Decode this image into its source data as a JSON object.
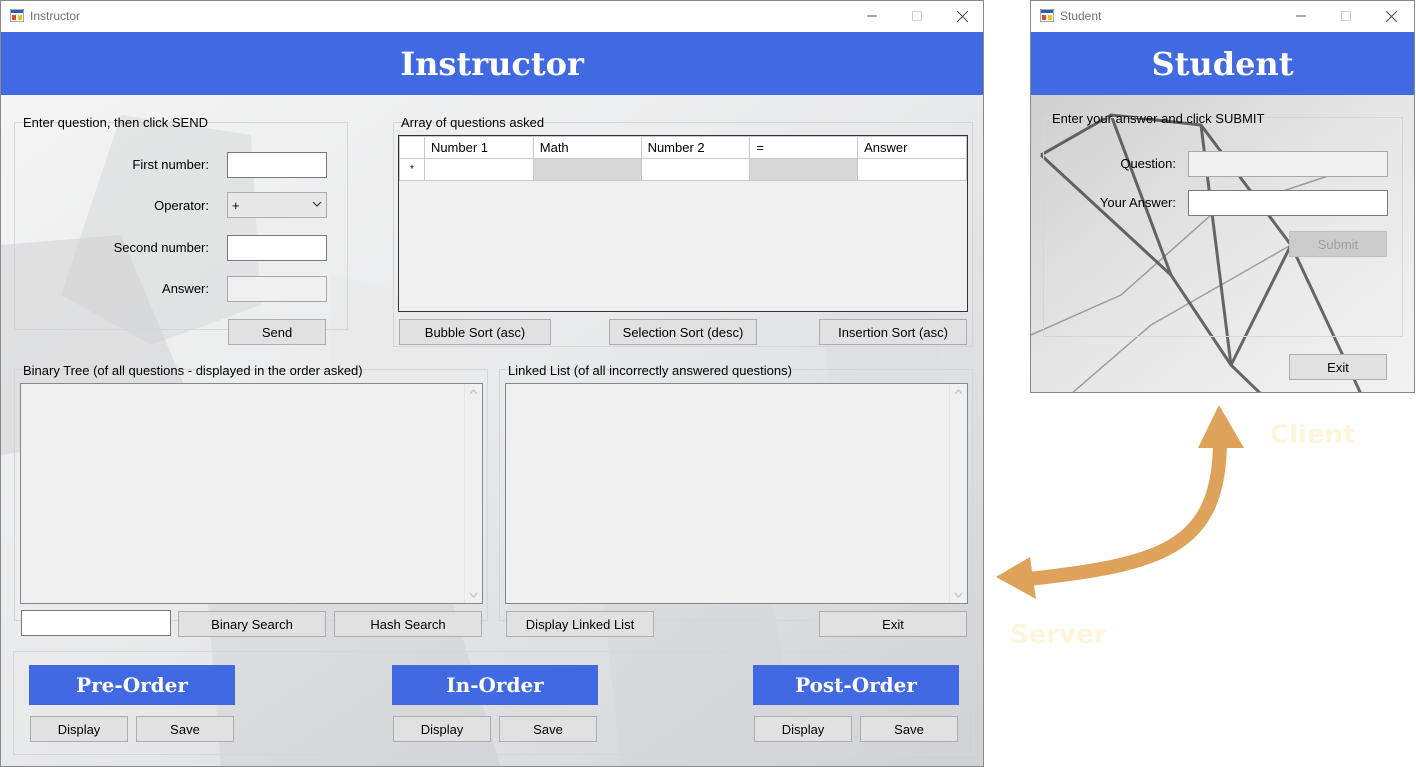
{
  "instructor": {
    "window_title": "Instructor",
    "banner": "Instructor",
    "question_group": {
      "label": "Enter question, then click SEND",
      "first_number_label": "First number:",
      "first_number_value": "",
      "operator_label": "Operator:",
      "operator_value": "+",
      "second_number_label": "Second number:",
      "second_number_value": "",
      "answer_label": "Answer:",
      "answer_value": "",
      "send_label": "Send"
    },
    "array_group": {
      "label": "Array of questions asked",
      "columns": [
        "Number 1",
        "Math",
        "Number 2",
        "=",
        "Answer"
      ],
      "new_row_marker": "*",
      "bubble_sort_label": "Bubble Sort (asc)",
      "selection_sort_label": "Selection Sort (desc)",
      "insertion_sort_label": "Insertion Sort (asc)"
    },
    "tree_group": {
      "label": "Binary Tree (of all questions - displayed in the order asked)",
      "search_value": "",
      "binary_search_label": "Binary Search",
      "hash_search_label": "Hash Search"
    },
    "linked_group": {
      "label": "Linked List (of all incorrectly answered questions)",
      "display_label": "Display Linked List",
      "exit_label": "Exit"
    },
    "traversal": {
      "pre_order": {
        "title": "Pre-Order",
        "display": "Display",
        "save": "Save"
      },
      "in_order": {
        "title": "In-Order",
        "display": "Display",
        "save": "Save"
      },
      "post_order": {
        "title": "Post-Order",
        "display": "Display",
        "save": "Save"
      }
    }
  },
  "student": {
    "window_title": "Student",
    "banner": "Student",
    "answer_group": {
      "label": "Enter your answer and click SUBMIT",
      "question_label": "Question:",
      "question_value": "",
      "your_answer_label": "Your Answer:",
      "your_answer_value": "",
      "submit_label": "Submit"
    },
    "exit_label": "Exit"
  },
  "annotations": {
    "client_label": "Client",
    "server_label": "Server",
    "arrow_color": "#dea25b",
    "label_color": "#fdf6dc"
  },
  "colors": {
    "banner": "#4169e1",
    "banner_text": "#ffffff"
  },
  "icons": {
    "app": "form-app-icon",
    "minimize": "minimize-icon",
    "maximize": "maximize-icon",
    "close": "close-icon",
    "dropdown": "chevron-down-icon",
    "scroll_up": "scroll-up-icon",
    "scroll_down": "scroll-down-icon"
  }
}
